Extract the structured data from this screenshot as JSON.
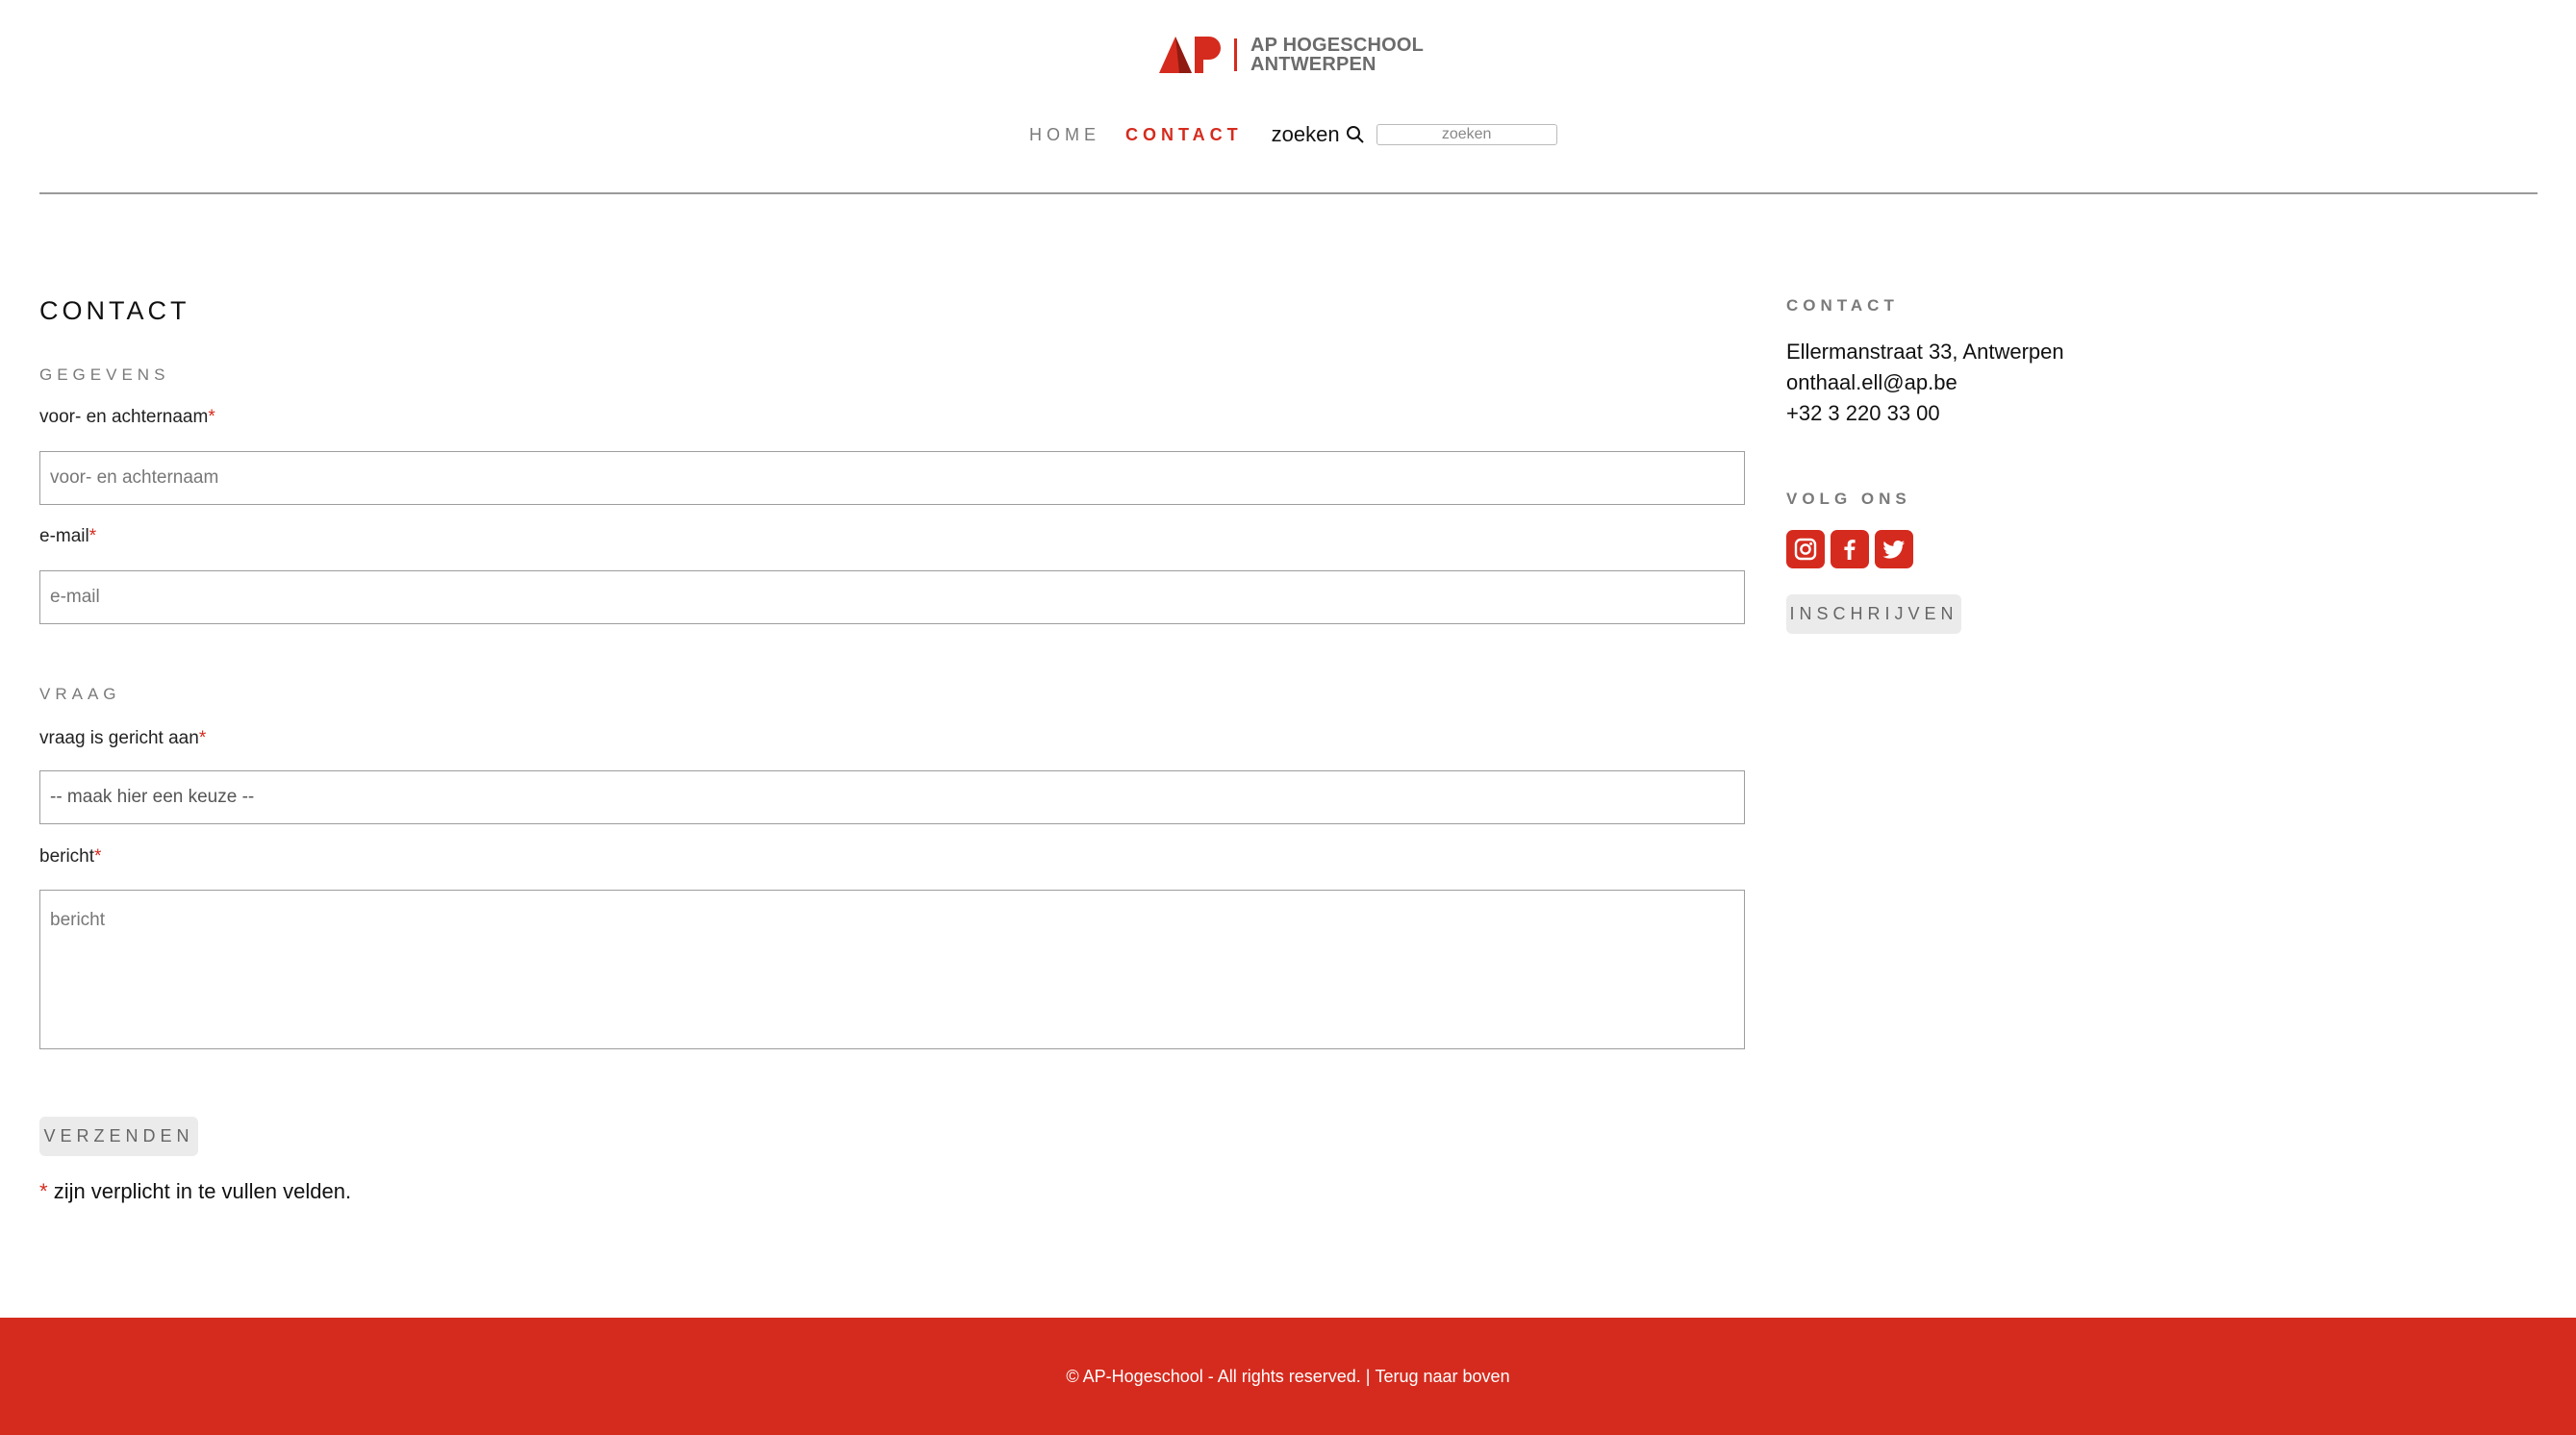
{
  "brand": {
    "name_line1": "AP HOGESCHOOL",
    "name_line2": "ANTWERPEN",
    "logo_icon": "ap-logo-icon",
    "accent_color": "#d52b1e"
  },
  "nav": {
    "items": [
      {
        "label": "HOME"
      },
      {
        "label": "CONTACT",
        "active": true
      }
    ],
    "search_label": "zoeken",
    "search_icon": "magnifier-icon",
    "search_placeholder": "zoeken"
  },
  "main": {
    "title": "CONTACT",
    "section_details": "GEGEVENS",
    "name_label": "voor- en achternaam",
    "name_placeholder": "voor- en achternaam",
    "email_label": "e-mail",
    "email_placeholder": "e-mail",
    "section_question": "VRAAG",
    "recipient_label": "vraag is gericht aan",
    "recipient_value": "-- maak hier een keuze --",
    "message_label": "bericht",
    "message_placeholder": "bericht",
    "required_marker": "*",
    "submit_label": "VERZENDEN",
    "required_note": "zijn verplicht in te vullen velden."
  },
  "sidebar": {
    "contact_heading": "CONTACT",
    "address": "Ellermanstraat 33, Antwerpen",
    "email": "onthaal.ell@ap.be",
    "phone": "+32 3 220 33 00",
    "follow_heading": "VOLG ONS",
    "social": [
      "instagram-icon",
      "facebook-icon",
      "twitter-icon"
    ],
    "subscribe_label": "INSCHRIJVEN"
  },
  "footer": {
    "copyright": "© AP-Hogeschool - All rights reserved.",
    "separator": " | ",
    "back_to_top": "Terug naar boven"
  }
}
